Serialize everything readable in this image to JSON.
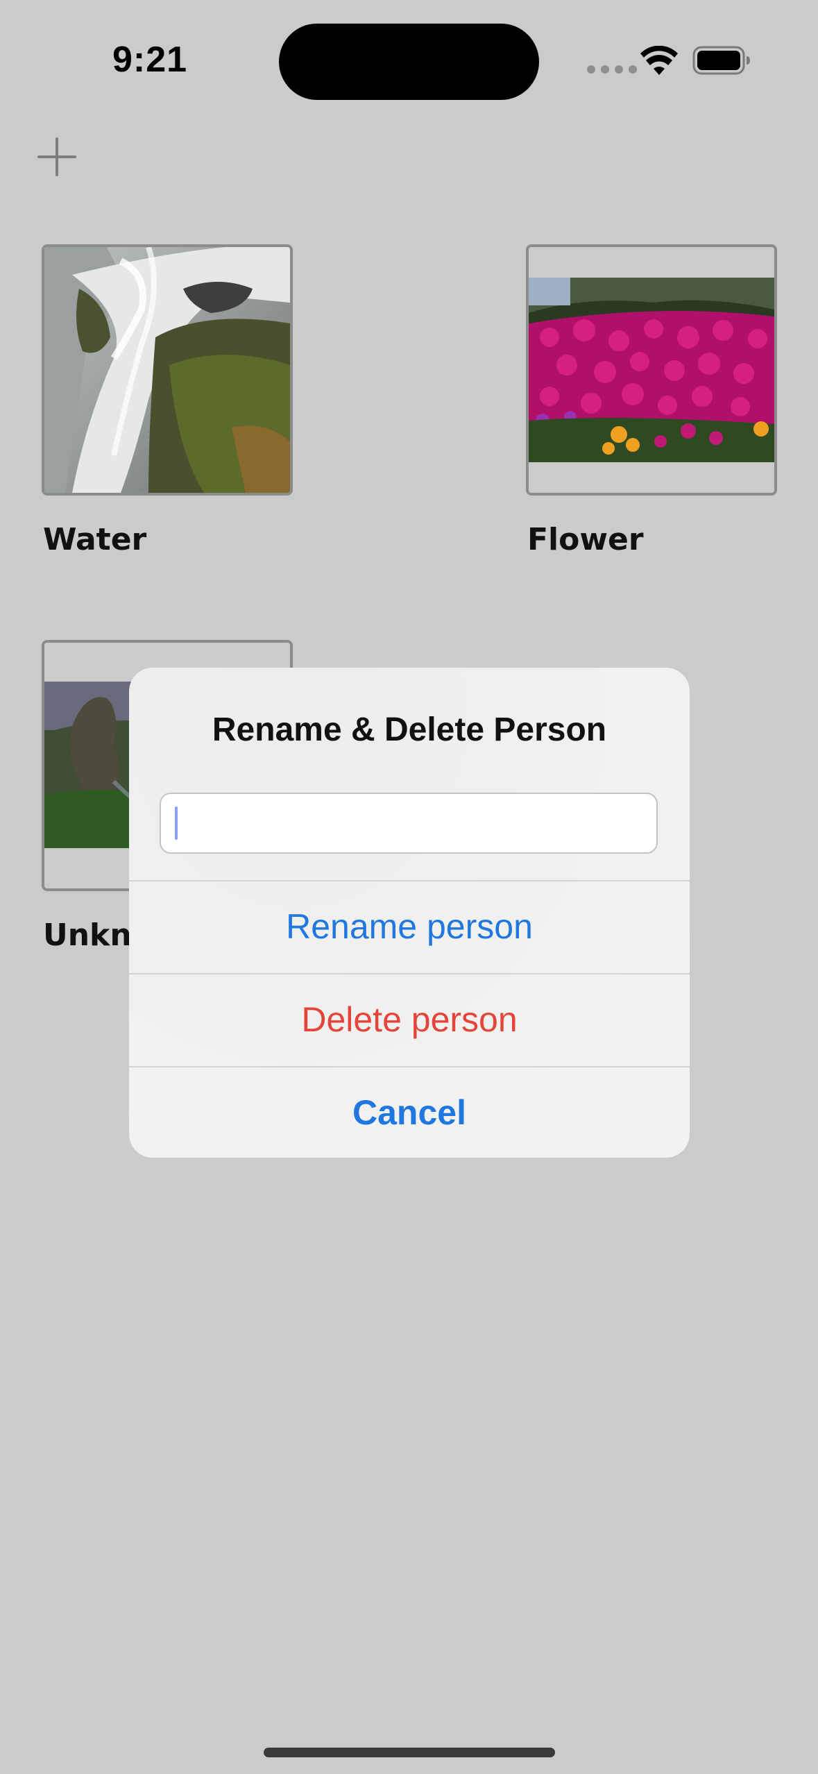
{
  "status_bar": {
    "time": "9:21"
  },
  "toolbar": {
    "add_icon": "plus-icon"
  },
  "people": [
    {
      "label": "Water"
    },
    {
      "label": "Flower"
    },
    {
      "label": "Unknown"
    }
  ],
  "alert": {
    "title": "Rename & Delete Person",
    "input_value": "",
    "input_placeholder": "",
    "rename_label": "Rename person",
    "delete_label": "Delete person",
    "cancel_label": "Cancel"
  },
  "colors": {
    "background": "#cbcbcb",
    "accent_blue": "#2077e0",
    "destructive_red": "#e4443a",
    "alert_background": "#f1f1f0"
  }
}
